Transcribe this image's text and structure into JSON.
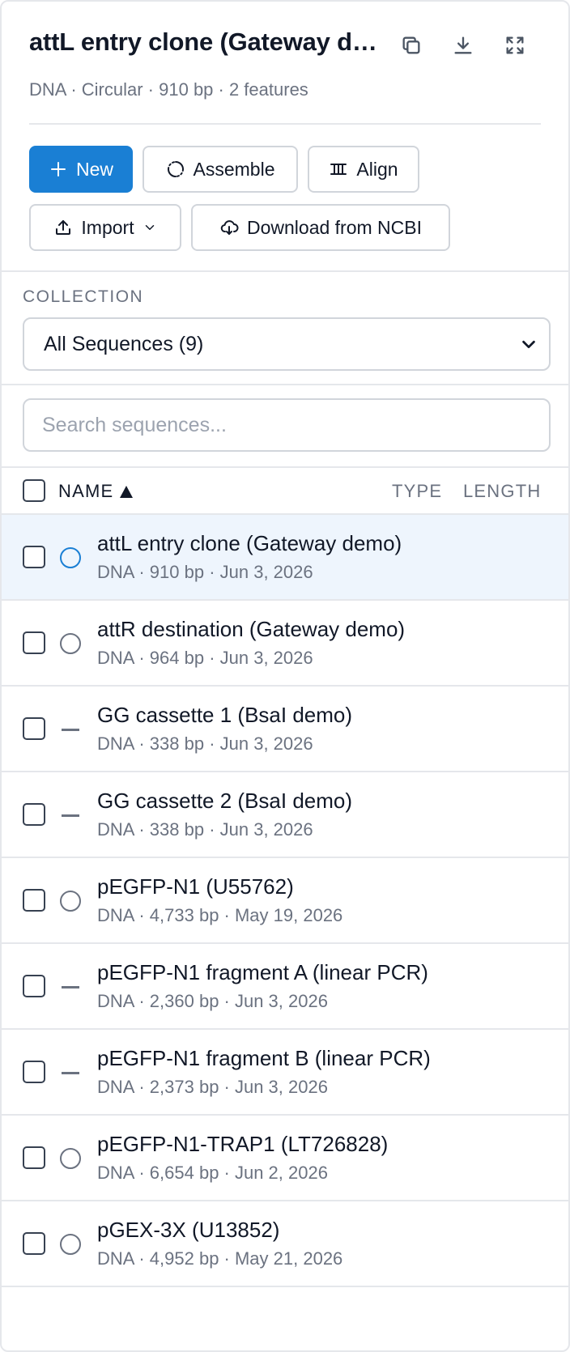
{
  "header": {
    "title": "attL entry clone (Gateway demo)",
    "subtitle": "DNA · Circular · 910 bp · 2 features"
  },
  "toolbar": {
    "new_label": "New",
    "assemble_label": "Assemble",
    "align_label": "Align",
    "import_label": "Import",
    "ncbi_label": "Download from NCBI"
  },
  "collection": {
    "label": "COLLECTION",
    "selected": "All Sequences (9)"
  },
  "search": {
    "placeholder": "Search sequences..."
  },
  "table": {
    "col_name": "NAME",
    "col_type": "TYPE",
    "col_length": "LENGTH"
  },
  "rows": [
    {
      "name": "attL entry clone (Gateway demo)",
      "meta": "DNA · 910 bp · Jun 3, 2026",
      "topology": "circular",
      "selected": true
    },
    {
      "name": "attR destination (Gateway demo)",
      "meta": "DNA · 964 bp · Jun 3, 2026",
      "topology": "circular",
      "selected": false
    },
    {
      "name": "GG cassette 1 (BsaI demo)",
      "meta": "DNA · 338 bp · Jun 3, 2026",
      "topology": "linear",
      "selected": false
    },
    {
      "name": "GG cassette 2 (BsaI demo)",
      "meta": "DNA · 338 bp · Jun 3, 2026",
      "topology": "linear",
      "selected": false
    },
    {
      "name": "pEGFP-N1 (U55762)",
      "meta": "DNA · 4,733 bp · May 19, 2026",
      "topology": "circular",
      "selected": false
    },
    {
      "name": "pEGFP-N1 fragment A (linear PCR)",
      "meta": "DNA · 2,360 bp · Jun 3, 2026",
      "topology": "linear",
      "selected": false
    },
    {
      "name": "pEGFP-N1 fragment B (linear PCR)",
      "meta": "DNA · 2,373 bp · Jun 3, 2026",
      "topology": "linear",
      "selected": false
    },
    {
      "name": "pEGFP-N1-TRAP1 (LT726828)",
      "meta": "DNA · 6,654 bp · Jun 2, 2026",
      "topology": "circular",
      "selected": false
    },
    {
      "name": "pGEX-3X (U13852)",
      "meta": "DNA · 4,952 bp · May 21, 2026",
      "topology": "circular",
      "selected": false
    }
  ],
  "colors": {
    "accent": "#1a7fd4",
    "selected_row": "#eef5fd",
    "border": "#e5e7eb",
    "muted_text": "#6b7280"
  }
}
